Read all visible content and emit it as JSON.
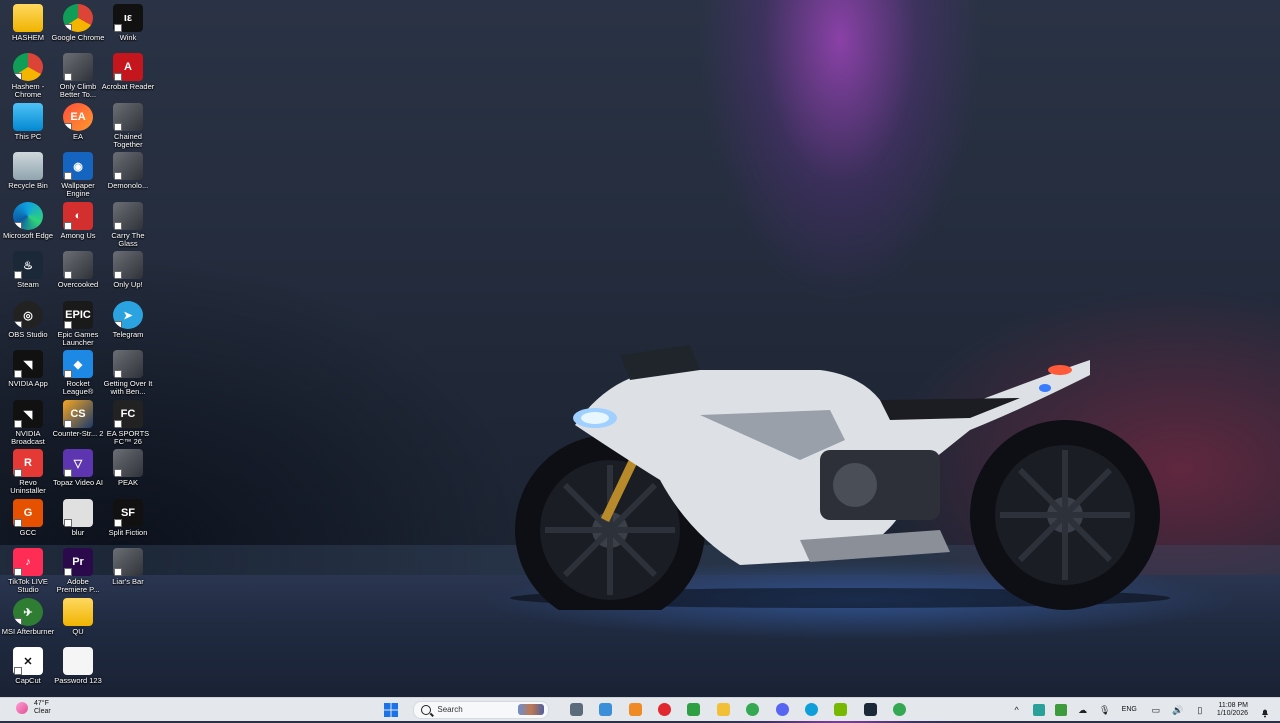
{
  "desktop_icons": [
    {
      "label": "HASHEM",
      "icon": "folder-icon",
      "col": 0,
      "row": 0
    },
    {
      "label": "Google Chrome",
      "icon": "chrome-icon",
      "col": 1,
      "row": 0
    },
    {
      "label": "Wink",
      "icon": "wink-icon",
      "col": 2,
      "row": 0
    },
    {
      "label": "Hashem - Chrome",
      "icon": "chrome-icon",
      "col": 0,
      "row": 1
    },
    {
      "label": "Only Climb Better To...",
      "icon": "game-icon",
      "col": 1,
      "row": 1
    },
    {
      "label": "Acrobat Reader",
      "icon": "acrobat-icon",
      "col": 2,
      "row": 1
    },
    {
      "label": "This PC",
      "icon": "monitor-icon",
      "col": 0,
      "row": 2
    },
    {
      "label": "EA",
      "icon": "ea-icon",
      "col": 1,
      "row": 2
    },
    {
      "label": "Chained Together",
      "icon": "game-icon",
      "col": 2,
      "row": 2
    },
    {
      "label": "Recycle Bin",
      "icon": "recycle-bin-icon",
      "col": 0,
      "row": 3
    },
    {
      "label": "Wallpaper Engine",
      "icon": "wallpaper-engine-icon",
      "col": 1,
      "row": 3
    },
    {
      "label": "Demonolo...",
      "icon": "game-icon",
      "col": 2,
      "row": 3
    },
    {
      "label": "Microsoft Edge",
      "icon": "edge-icon",
      "col": 0,
      "row": 4
    },
    {
      "label": "Among Us",
      "icon": "among-us-icon",
      "col": 1,
      "row": 4
    },
    {
      "label": "Carry The Glass",
      "icon": "game-icon",
      "col": 2,
      "row": 4
    },
    {
      "label": "Steam",
      "icon": "steam-icon",
      "col": 0,
      "row": 5
    },
    {
      "label": "Overcooked",
      "icon": "game-icon",
      "col": 1,
      "row": 5
    },
    {
      "label": "Only Up!",
      "icon": "game-icon",
      "col": 2,
      "row": 5
    },
    {
      "label": "OBS Studio",
      "icon": "obs-icon",
      "col": 0,
      "row": 6
    },
    {
      "label": "Epic Games Launcher",
      "icon": "epic-games-icon",
      "col": 1,
      "row": 6
    },
    {
      "label": "Telegram",
      "icon": "telegram-icon",
      "col": 2,
      "row": 6
    },
    {
      "label": "NVIDIA App",
      "icon": "nvidia-icon",
      "col": 0,
      "row": 7
    },
    {
      "label": "Rocket League®",
      "icon": "rocket-league-icon",
      "col": 1,
      "row": 7
    },
    {
      "label": "Getting Over It with Ben...",
      "icon": "game-icon",
      "col": 2,
      "row": 7
    },
    {
      "label": "NVIDIA Broadcast",
      "icon": "nvidia-icon",
      "col": 0,
      "row": 8
    },
    {
      "label": "Counter-Str... 2",
      "icon": "counter-strike-icon",
      "col": 1,
      "row": 8
    },
    {
      "label": "EA SPORTS FC™ 26",
      "icon": "ea-sports-icon",
      "col": 2,
      "row": 8
    },
    {
      "label": "Revo Uninstaller",
      "icon": "revo-icon",
      "col": 0,
      "row": 9
    },
    {
      "label": "Topaz Video AI",
      "icon": "topaz-icon",
      "col": 1,
      "row": 9
    },
    {
      "label": "PEAK",
      "icon": "game-icon",
      "col": 2,
      "row": 9
    },
    {
      "label": "GCC",
      "icon": "gcc-icon",
      "col": 0,
      "row": 10
    },
    {
      "label": "blur",
      "icon": "blur-icon",
      "col": 1,
      "row": 10
    },
    {
      "label": "Split Fiction",
      "icon": "split-fiction-icon",
      "col": 2,
      "row": 10
    },
    {
      "label": "TikTok LIVE Studio",
      "icon": "tiktok-icon",
      "col": 0,
      "row": 11
    },
    {
      "label": "Adobe Premiere P...",
      "icon": "premiere-icon",
      "col": 1,
      "row": 11
    },
    {
      "label": "Liar's Bar",
      "icon": "game-icon",
      "col": 2,
      "row": 11
    },
    {
      "label": "MSI Afterburner",
      "icon": "msi-afterburner-icon",
      "col": 0,
      "row": 12
    },
    {
      "label": "QU",
      "icon": "folder-icon",
      "col": 1,
      "row": 12
    },
    {
      "label": "CapCut",
      "icon": "capcut-icon",
      "col": 0,
      "row": 13
    },
    {
      "label": "Password 123",
      "icon": "text-file-icon",
      "col": 1,
      "row": 13
    }
  ],
  "taskbar": {
    "weather": {
      "temp": "47°F",
      "condition": "Clear"
    },
    "search_placeholder": "Search",
    "pinned": [
      "settings-icon",
      "photos-icon",
      "cloud-icon",
      "opera-icon",
      "xbox-icon",
      "file-explorer-icon",
      "chrome-icon",
      "discord-icon",
      "edge-icon",
      "nvidia-icon",
      "steam-icon",
      "chrome-icon"
    ],
    "tray": {
      "language": "ENG",
      "time": "11:08 PM",
      "date": "1/10/2026"
    }
  }
}
